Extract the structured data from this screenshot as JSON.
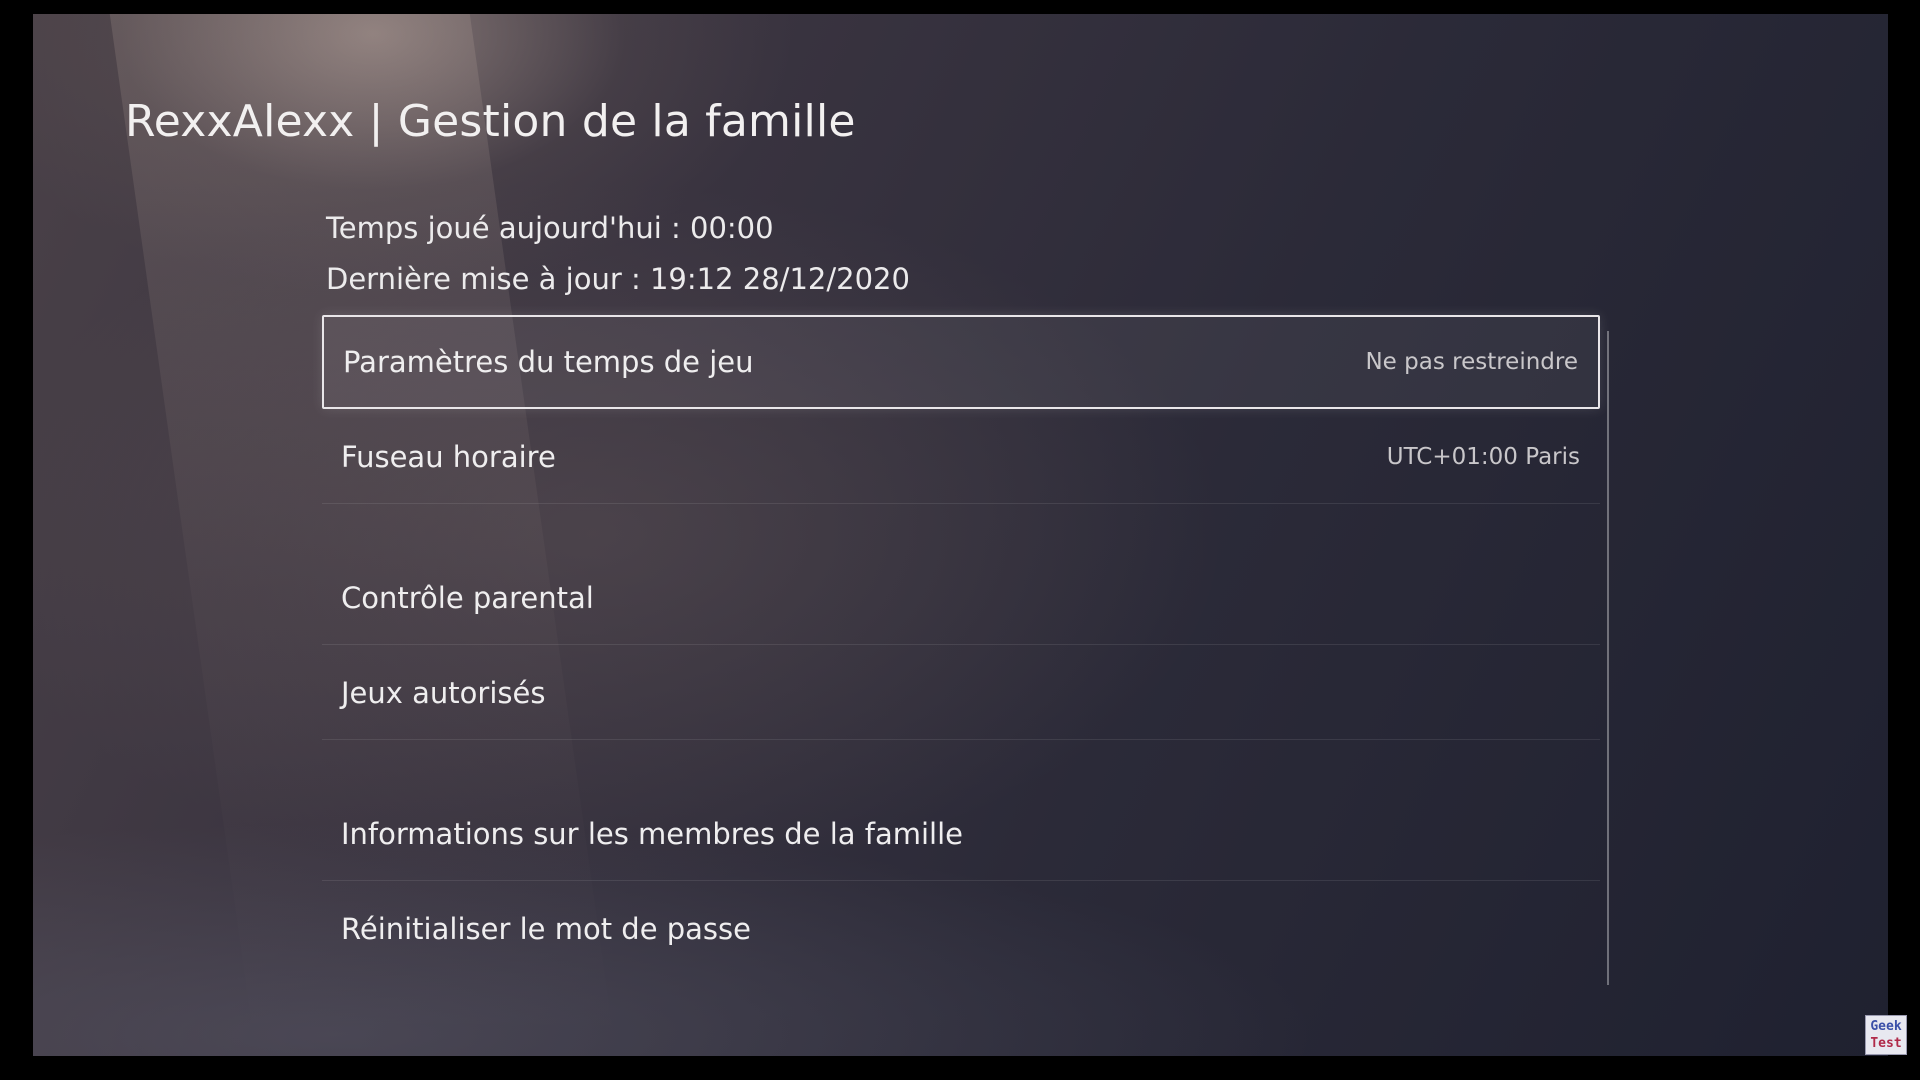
{
  "header": {
    "title": "RexxAlexx | Gestion de la famille"
  },
  "info": {
    "played_today": "Temps joué aujourd'hui : 00:00",
    "last_update": "Dernière mise à jour : 19:12 28/12/2020"
  },
  "menu": {
    "items": [
      {
        "label": "Paramètres du temps de jeu",
        "value": "Ne pas restreindre",
        "focused": true
      },
      {
        "label": "Fuseau horaire",
        "value": "UTC+01:00 Paris"
      },
      {
        "label": "Contrôle parental"
      },
      {
        "label": "Jeux autorisés"
      },
      {
        "label": "Informations sur les membres de la famille"
      },
      {
        "label": "Réinitialiser le mot de passe"
      }
    ]
  },
  "watermark": {
    "line1": "Geek",
    "line2": "Test"
  },
  "colors": {
    "focus_border": "#e9e6e9",
    "background": "#2b2a38"
  }
}
